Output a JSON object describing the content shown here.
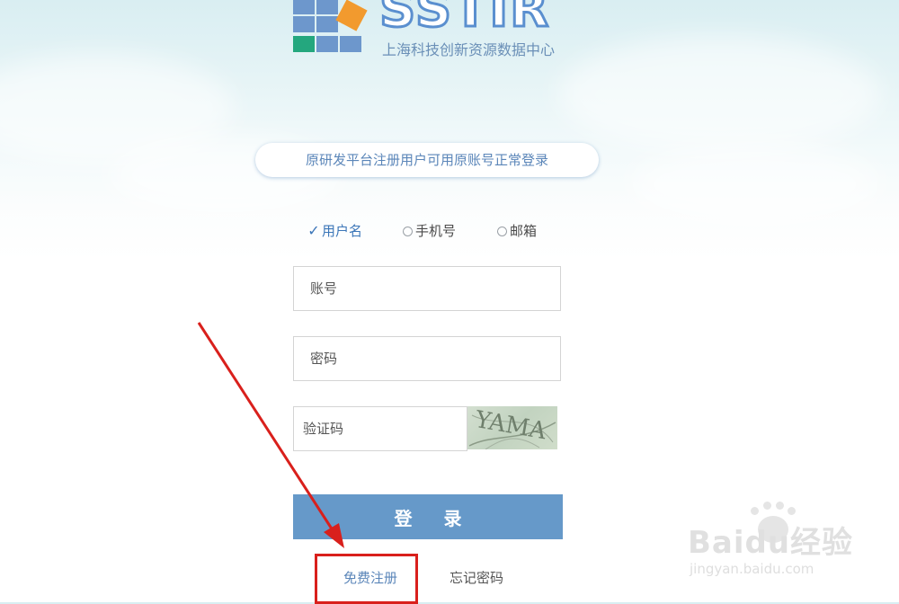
{
  "logo": {
    "wordmark": "SSTIR",
    "subtitle": "上海科技创新资源数据中心"
  },
  "notice": "原研发平台注册用户可用原账号正常登录",
  "login_types": [
    {
      "label": "用户名",
      "selected": true
    },
    {
      "label": "手机号",
      "selected": false
    },
    {
      "label": "邮箱",
      "selected": false
    }
  ],
  "fields": {
    "account_placeholder": "账号",
    "password_placeholder": "密码",
    "captcha_placeholder": "验证码",
    "captcha_text": "YAMA"
  },
  "login_button": "登 录",
  "links": {
    "register": "免费注册",
    "forgot": "忘记密码"
  },
  "watermark": {
    "brand": "Baidu经验",
    "url": "jingyan.baidu.com"
  },
  "colors": {
    "accent": "#6699c9",
    "link": "#5b86b9",
    "annotation": "#d9201c"
  }
}
